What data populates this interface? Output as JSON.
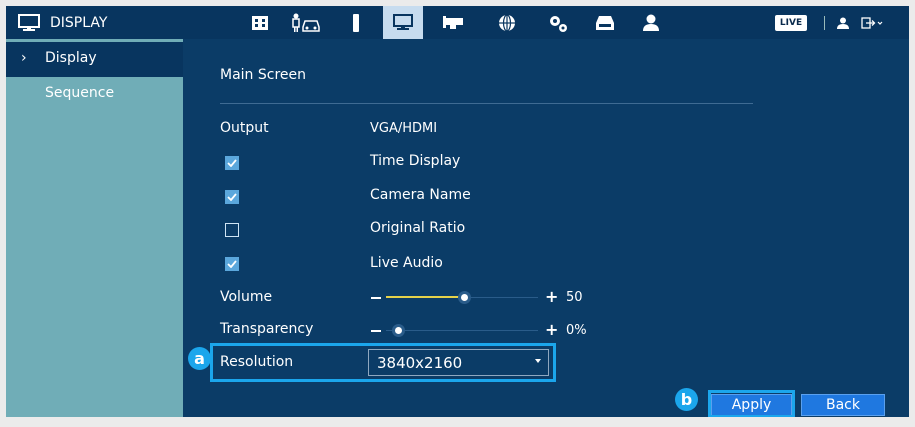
{
  "topbar": {
    "title": "DISPLAY",
    "live_label": "LIVE",
    "nav_icons": [
      "video-icon",
      "intelligent-icon",
      "storage-icon",
      "display-icon",
      "camera-icon",
      "network-icon",
      "settings-icon",
      "backup-icon",
      "account-icon"
    ],
    "active_icon": "display-icon"
  },
  "sidebar": {
    "items": [
      {
        "label": "Display",
        "active": true,
        "chevron": "›"
      },
      {
        "label": "Sequence",
        "active": false
      }
    ]
  },
  "main": {
    "section_title": "Main Screen",
    "output_label": "Output",
    "output_value": "VGA/HDMI",
    "checkboxes": [
      {
        "label": "Time Display",
        "checked": true
      },
      {
        "label": "Camera Name",
        "checked": true
      },
      {
        "label": "Original Ratio",
        "checked": false
      },
      {
        "label": "Live Audio",
        "checked": true
      }
    ],
    "volume_label": "Volume",
    "volume_value": "50",
    "volume_level": 0.5,
    "transparency_label": "Transparency",
    "transparency_value": "0%",
    "transparency_level": 0.0,
    "resolution_label": "Resolution",
    "resolution_value": "3840x2160",
    "apply_label": "Apply",
    "back_label": "Back"
  },
  "annotations": {
    "a": "a",
    "b": "b"
  },
  "colors": {
    "topbar": "#08355f",
    "content": "#0b3c67",
    "sidebar": "#70adb7",
    "accent": "#1ba6ec",
    "button": "#1f78e0",
    "slider_fill": "#e5d24a"
  }
}
